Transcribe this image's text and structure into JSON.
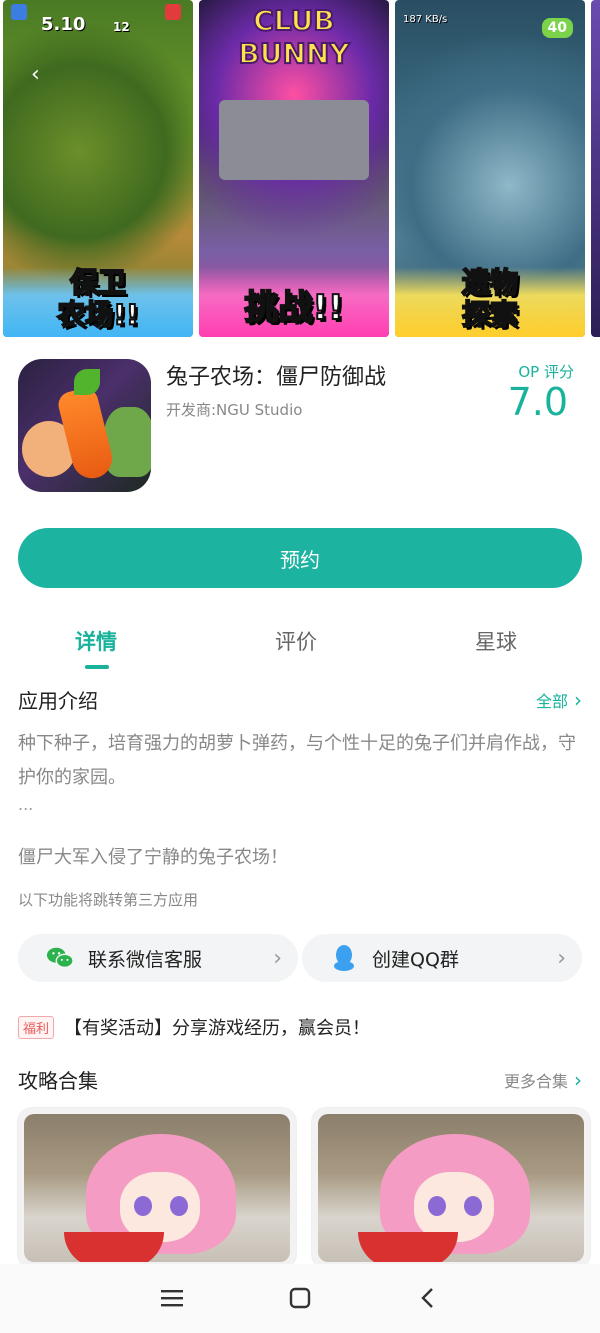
{
  "carousel": {
    "shots": [
      {
        "caption_line1": "保卫",
        "caption_line2": "农场!!",
        "hud_time": "5.10",
        "hud_extra": "12"
      },
      {
        "top_title": "CLUB BUNNY",
        "caption": "挑战!!"
      },
      {
        "caption_line1": "遗物",
        "caption_line2": "探索",
        "speed": "187 KB/s",
        "badge": "40"
      }
    ]
  },
  "app": {
    "title": "兔子农场：僵尸防御战",
    "developer": "开发商:NGU Studio",
    "score_label": "OP 评分",
    "score_value": "7.0"
  },
  "reserve_button": "预约",
  "tabs": [
    {
      "label": "详情",
      "active": true
    },
    {
      "label": "评价",
      "active": false
    },
    {
      "label": "星球",
      "active": false
    }
  ],
  "intro": {
    "title": "应用介绍",
    "all_link": "全部",
    "text1": "种下种子，培育强力的胡萝卜弹药，与个性十足的兔子们并肩作战，守护你的家园。",
    "dots": "...",
    "text2": "僵尸大军入侵了宁静的兔子农场！",
    "third_party_note": "以下功能将跳转第三方应用"
  },
  "contact": {
    "wechat": "联系微信客服",
    "qq": "创建QQ群"
  },
  "promo": {
    "tag": "福利",
    "text": "【有奖活动】分享游戏经历，赢会员！"
  },
  "guides": {
    "title": "攻略合集",
    "more": "更多合集"
  },
  "colors": {
    "accent": "#1cb3a0",
    "text_primary": "#222222",
    "text_secondary": "#888888"
  },
  "icons": {
    "wechat": "wechat-icon",
    "qq": "qq-icon",
    "chevron": "chevron-right-icon",
    "nav_menu": "menu-icon",
    "nav_home": "home-square-icon",
    "nav_back": "back-icon"
  }
}
